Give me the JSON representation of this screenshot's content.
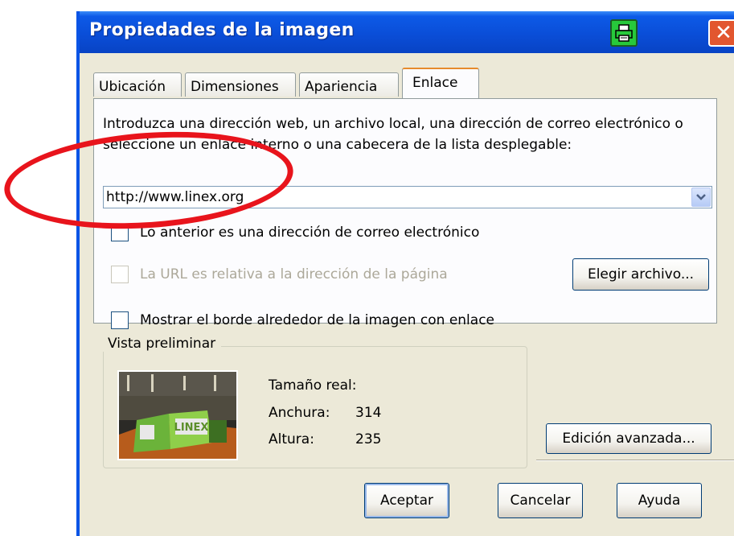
{
  "window": {
    "title": "Propiedades de la imagen",
    "close_label": "✕"
  },
  "tabs": [
    {
      "label": "Ubicación",
      "active": false
    },
    {
      "label": "Dimensiones",
      "active": false
    },
    {
      "label": "Apariencia",
      "active": false
    },
    {
      "label": "Enlace",
      "active": true
    }
  ],
  "link": {
    "intro": "Introduzca una dirección web, un archivo local, una dirección de correo electrónico o seleccione un enlace interno o una cabecera de la lista desplegable:",
    "url_value": "http://www.linex.org",
    "email_checkbox_label": "Lo anterior es una dirección de correo electrónico",
    "relative_checkbox_label": "La URL es relativa a la dirección de la página",
    "choose_file_button": "Elegir archivo...",
    "border_checkbox_label": "Mostrar el borde alrededor de la imagen con enlace"
  },
  "preview": {
    "legend": "Vista preliminar",
    "real_size_label": "Tamaño real:",
    "width_label": "Anchura:",
    "width_value": "314",
    "height_label": "Altura:",
    "height_value": "235",
    "image_logo_text": "LINEX"
  },
  "buttons": {
    "advanced_edit": "Edición avanzada...",
    "ok": "Aceptar",
    "cancel": "Cancelar",
    "help": "Ayuda"
  },
  "colors": {
    "titlebar": "#0a4ed8",
    "dialog_bg": "#ece9d8",
    "annotation": "#e8141c",
    "print_icon": "#27c93b"
  }
}
